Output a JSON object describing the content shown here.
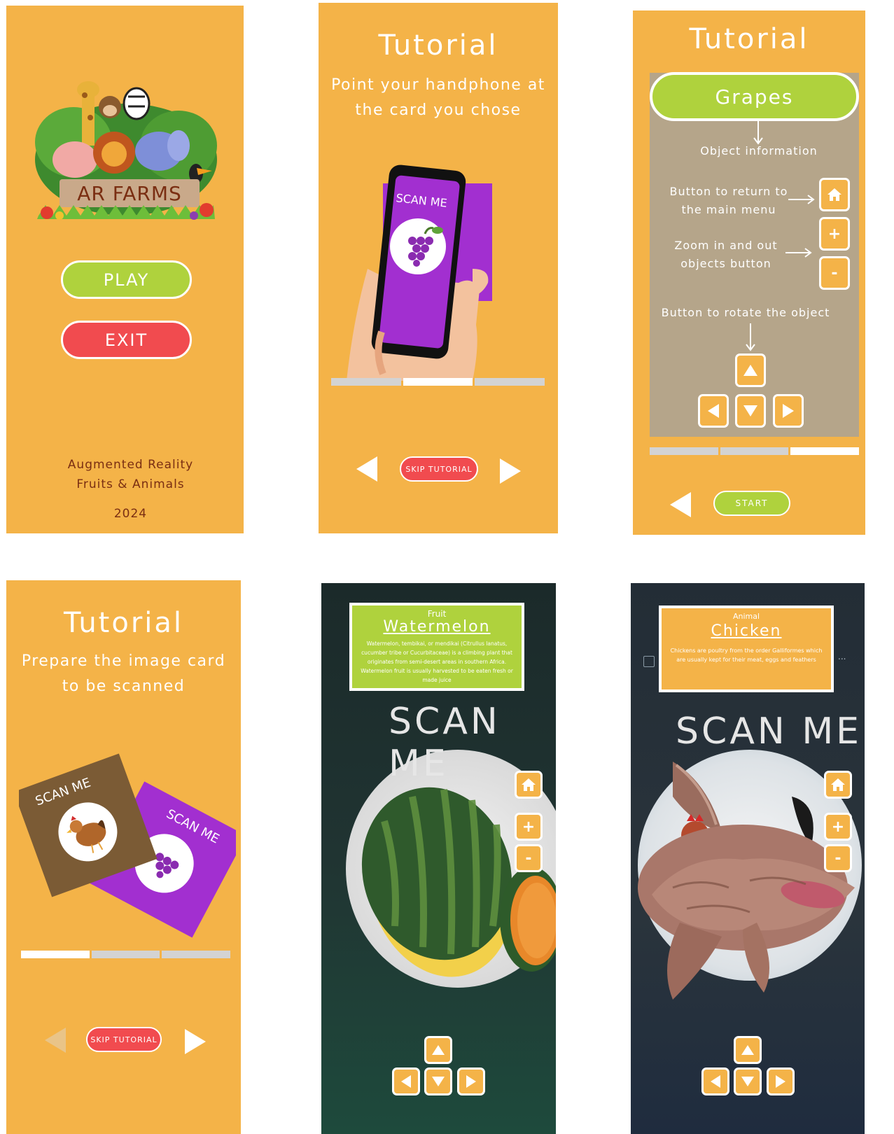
{
  "menu_screen": {
    "logo_text": "AR FARMS",
    "play_label": "PLAY",
    "exit_label": "EXIT",
    "footer_line1": "Augmented Reality",
    "footer_line2": "Fruits & Animals",
    "year": "2024"
  },
  "tutorial_point": {
    "title": "Tutorial",
    "subtitle_line1": "Point your handphone at",
    "subtitle_line2": "the card you chose",
    "card_label": "SCAN ME",
    "skip_label": "SKIP TUTORIAL",
    "progress_active": 2
  },
  "tutorial_buttons": {
    "title": "Tutorial",
    "object_name": "Grapes",
    "object_info_label": "Object information",
    "home_label_line1": "Button to return to",
    "home_label_line2": "the main menu",
    "zoom_label_line1": "Zoom in and out",
    "zoom_label_line2": "objects button",
    "rotate_label": "Button to rotate the object",
    "zoom_in_symbol": "+",
    "zoom_out_symbol": "-",
    "start_label": "START",
    "progress_active": 3
  },
  "tutorial_prepare": {
    "title": "Tutorial",
    "subtitle_line1": "Prepare the image card",
    "subtitle_line2": "to be scanned",
    "card1_label": "SCAN ME",
    "card2_label": "SCAN ME",
    "skip_label": "SKIP TUTORIAL",
    "progress_active": 1
  },
  "ar_watermelon": {
    "category": "Fruit",
    "name": "Watermelon",
    "description": "Watermelon, tembikai, or mendikai (Citrullus lanatus, cucumber tribe or Cucurbitaceae) is a climbing plant that originates from semi-desert areas in southern Africa. Watermelon fruit is usually harvested to be eaten fresh or made juice",
    "scan_label": "SCAN ME",
    "zoom_in_symbol": "+",
    "zoom_out_symbol": "-"
  },
  "ar_chicken": {
    "category": "Animal",
    "name": "Chicken",
    "description": "Chickens are poultry from the order Galliformes which are usually kept for their meat, eggs and feathers",
    "scan_label": "SCAN ME",
    "zoom_in_symbol": "+",
    "zoom_out_symbol": "-",
    "overflow_symbol": "..."
  },
  "colors": {
    "background_orange": "#F4B348",
    "play_green": "#AFD23D",
    "exit_red": "#F14B4F",
    "card_purple": "#A22FD0",
    "card_brown": "#7B5B35",
    "panel_taupe": "#B5A58A",
    "dark_text": "#7A2E12"
  }
}
